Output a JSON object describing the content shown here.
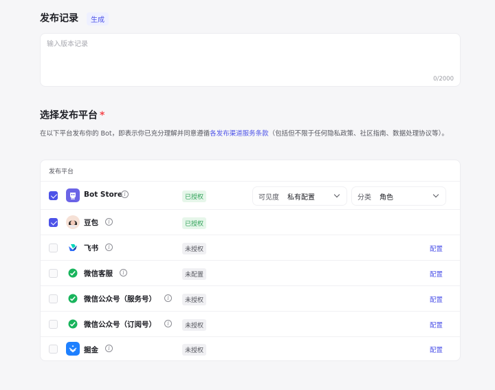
{
  "release": {
    "title": "发布记录",
    "generate_label": "生成",
    "placeholder": "输入版本记录",
    "counter": "0/2000"
  },
  "platform_section": {
    "title": "选择发布平台",
    "required_mark": "*",
    "desc_prefix": "在以下平台发布你的 Bot，即表示你已充分理解并同意遵循",
    "desc_link": "各发布渠道服务条款",
    "desc_suffix": "（包括但不限于任何隐私政策、社区指南、数据处理协议等）。"
  },
  "table": {
    "header": "发布平台",
    "visibility_label": "可见度",
    "visibility_value": "私有配置",
    "category_label": "分类",
    "category_value": "角色",
    "config_label": "配置",
    "platforms": [
      {
        "name": "Bot Store",
        "status": "已授权",
        "checked": true,
        "icon": "bot-store-icon",
        "color": "#6b64e6"
      },
      {
        "name": "豆包",
        "status": "已授权",
        "checked": true,
        "icon": "doubao-avatar-icon",
        "color": "#f2c9b8"
      },
      {
        "name": "飞书",
        "status": "未授权",
        "checked": false,
        "icon": "feishu-icon",
        "color": "#2e6cf6"
      },
      {
        "name": "微信客服",
        "status": "未配置",
        "checked": false,
        "icon": "wechat-icon",
        "color": "#18b45c"
      },
      {
        "name": "微信公众号（服务号）",
        "status": "未授权",
        "checked": false,
        "icon": "wechat-icon",
        "color": "#18b45c"
      },
      {
        "name": "微信公众号（订阅号）",
        "status": "未授权",
        "checked": false,
        "icon": "wechat-icon",
        "color": "#18b45c"
      },
      {
        "name": "掘金",
        "status": "未授权",
        "checked": false,
        "icon": "juejin-icon",
        "color": "#1e80ff"
      }
    ]
  }
}
